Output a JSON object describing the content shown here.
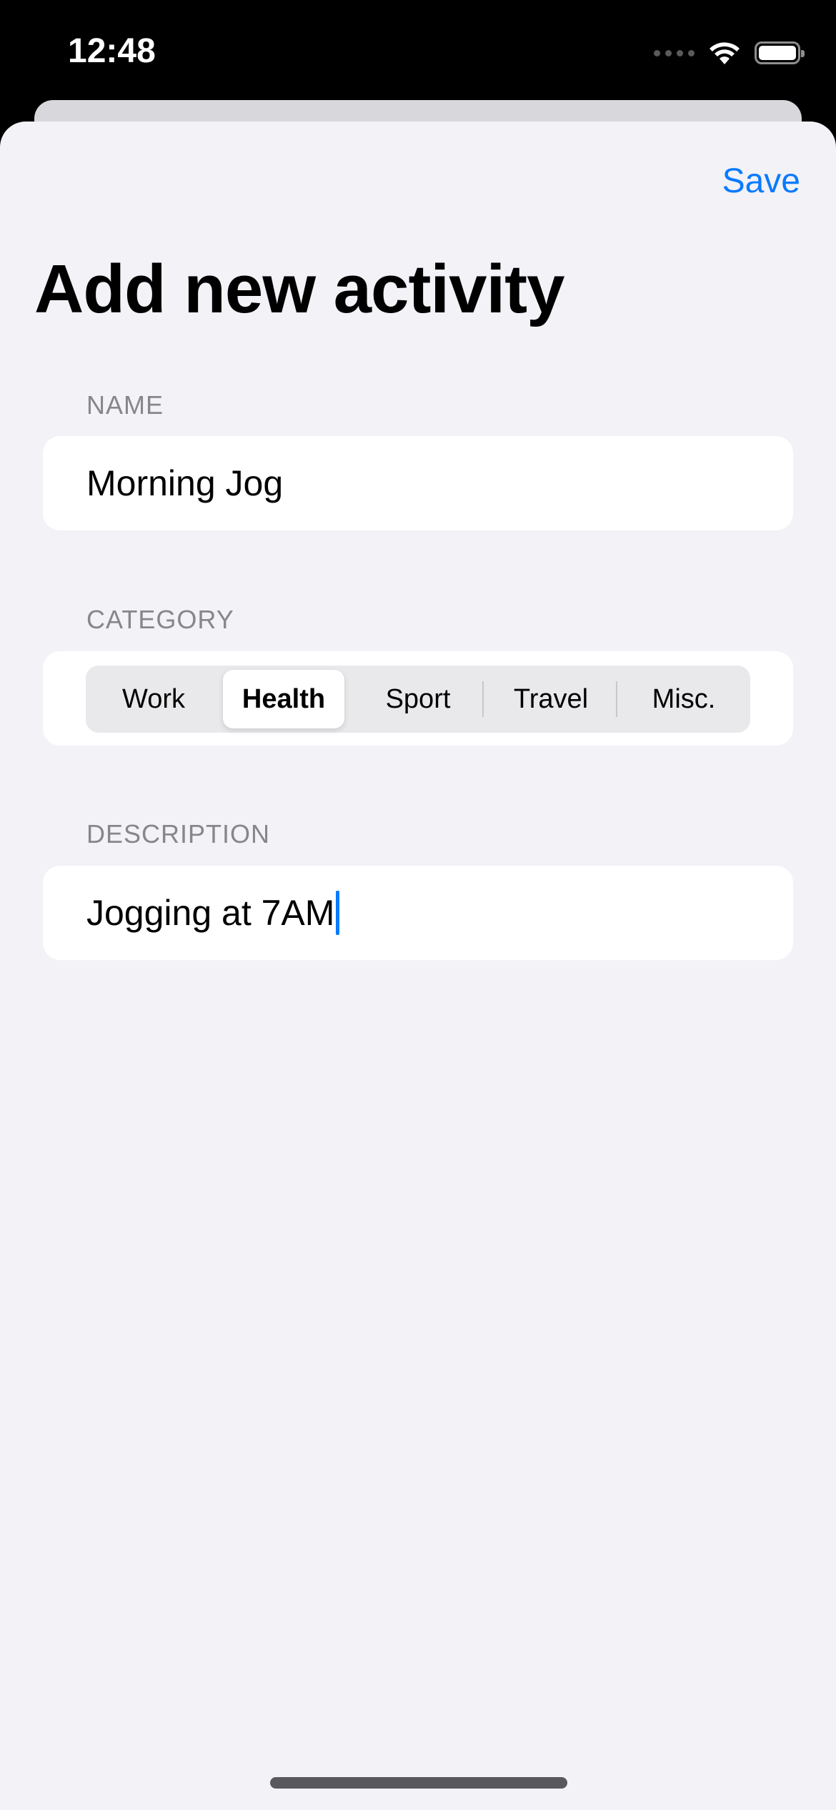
{
  "status_bar": {
    "time": "12:48",
    "icons": [
      "cellular-signal-icon",
      "wifi-icon",
      "battery-icon"
    ]
  },
  "header": {
    "save_label": "Save",
    "title": "Add new activity"
  },
  "form": {
    "name": {
      "label": "NAME",
      "value": "Morning Jog"
    },
    "category": {
      "label": "CATEGORY",
      "options": [
        "Work",
        "Health",
        "Sport",
        "Travel",
        "Misc."
      ],
      "selected": "Health"
    },
    "description": {
      "label": "DESCRIPTION",
      "value": "Jogging at 7AM"
    }
  },
  "colors": {
    "accent": "#0a7aff",
    "background": "#f2f2f7",
    "label_gray": "#86868b"
  }
}
